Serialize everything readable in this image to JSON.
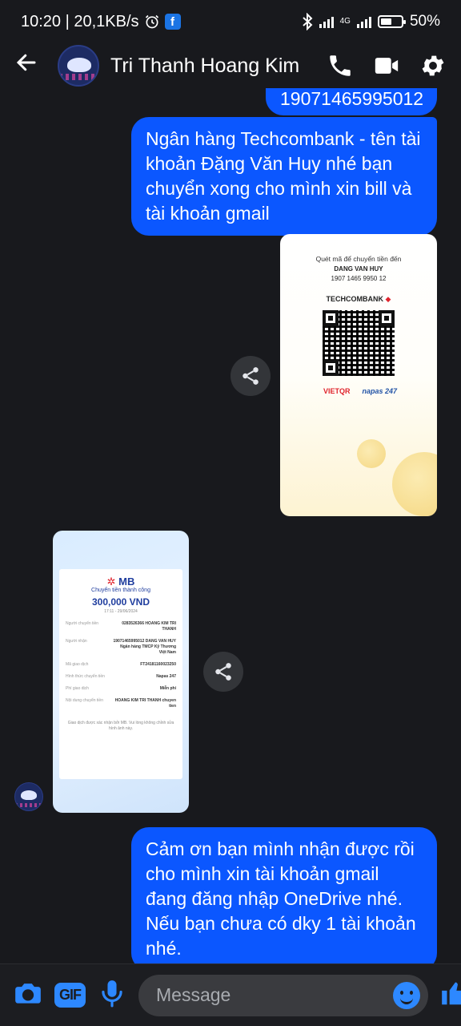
{
  "status_bar": {
    "time_speed": "10:20 | 20,1KB/s",
    "network": "4G",
    "battery": "50%",
    "fb_badge": "f"
  },
  "header": {
    "contact_name": "Tri Thanh Hoang Kim"
  },
  "messages": {
    "partial_top": "19071465995012",
    "out_1": "Ngân hàng Techcombank - tên tài khoản Đặng Văn Huy nhé bạn chuyển xong cho mình xin bill và tài khoản gmail",
    "out_3": "Cảm ơn bạn mình nhận được rồi cho mình xin tài khoản gmail đang đăng nhập OneDrive nhé. Nếu bạn chưa có dky 1 tài khoản nhé."
  },
  "qr_image": {
    "line1": "Quét mã để chuyển tiền đến",
    "name": "DANG VAN HUY",
    "account": "1907 1465 9950 12",
    "bank": "TECHCOMBANK",
    "logo_left": "VIETQR",
    "logo_right": "napas 247"
  },
  "receipt_image": {
    "logo": "MB",
    "status": "Chuyển tiền thành công",
    "amount": "300,000 VND",
    "date": "17:11 - 29/06/2024",
    "rows": [
      {
        "k": "Người chuyển tiền",
        "v": "0283526366 HOANG KIM TRI THANH"
      },
      {
        "k": "Người nhận",
        "v": "19071465995012 DANG VAN HUY Ngân hàng TMCP Kỹ Thương Việt Nam"
      },
      {
        "k": "Mã giao dịch",
        "v": "FT24181160023250"
      },
      {
        "k": "Hình thức chuyển tiền",
        "v": "Napas 247"
      },
      {
        "k": "Phí giao dịch",
        "v": "Miễn phí"
      },
      {
        "k": "Nội dung chuyển tiền",
        "v": "HOANG KIM TRI THANH chuyen tien"
      }
    ],
    "footer": "Giao dịch được xác nhận bởi MB. Vui lòng không chỉnh sửa hình ảnh này."
  },
  "composer": {
    "gif_label": "GIF",
    "placeholder": "Message"
  },
  "colors": {
    "bubble_out": "#0b57ff",
    "accent": "#2d88ff",
    "background": "#18191d"
  }
}
